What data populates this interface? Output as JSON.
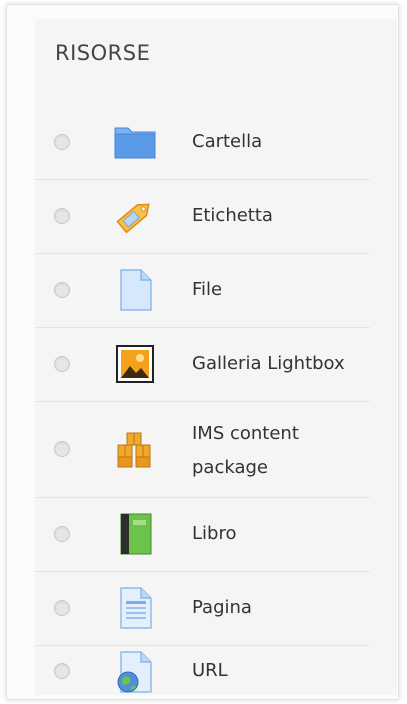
{
  "section": {
    "title": "RISORSE"
  },
  "items": [
    {
      "label": "Cartella",
      "icon": "folder-icon"
    },
    {
      "label": "Etichetta",
      "icon": "tag-icon"
    },
    {
      "label": "File",
      "icon": "file-icon"
    },
    {
      "label": "Galleria Lightbox",
      "icon": "image-gallery-icon"
    },
    {
      "label_line1": "IMS content",
      "label_line2": "package",
      "icon": "ims-package-icon"
    },
    {
      "label": "Libro",
      "icon": "book-icon"
    },
    {
      "label": "Pagina",
      "icon": "page-icon"
    },
    {
      "label": "URL",
      "icon": "url-globe-icon"
    }
  ],
  "colors": {
    "panel": "#f5f5f5",
    "text": "#333333",
    "folder": "#5b9ae6",
    "tag": "#f0a92c",
    "book": "#6cc24a"
  }
}
